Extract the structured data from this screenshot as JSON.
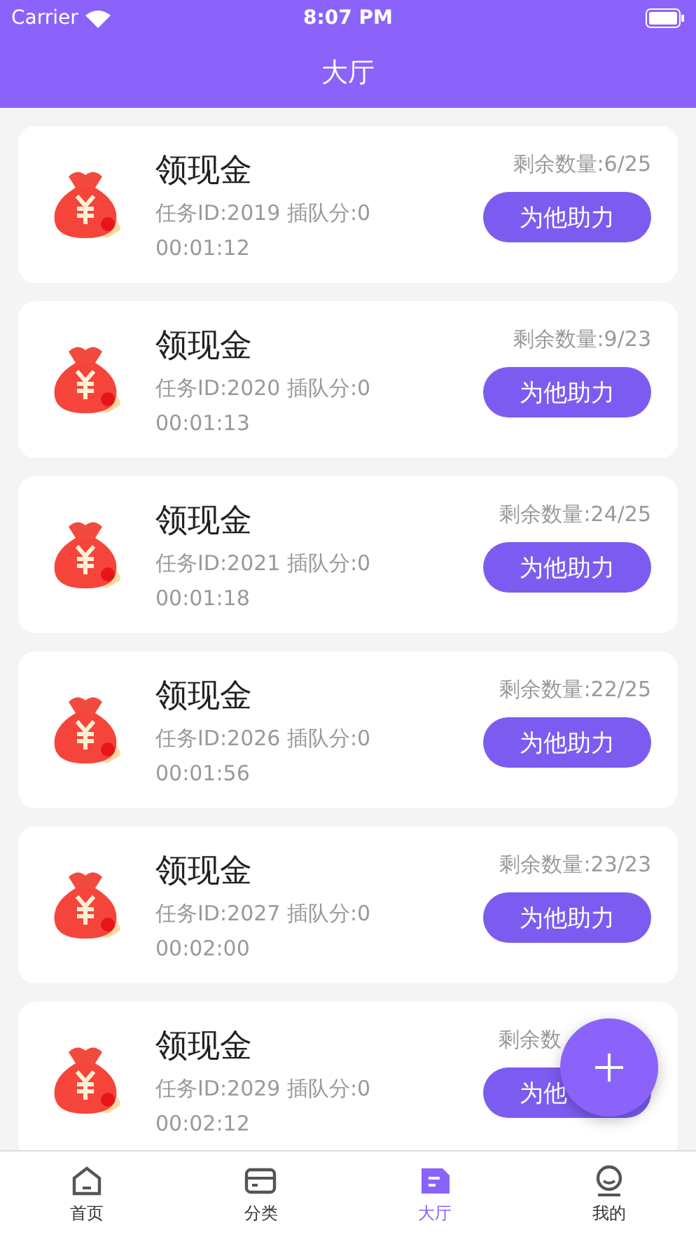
{
  "status_bar": {
    "carrier": "Carrier",
    "time": "8:07 PM"
  },
  "header": {
    "title": "大厅"
  },
  "tasks": [
    {
      "title": "领现金",
      "remaining": "剩余数量:6/25",
      "info": "任务ID:2019 插队分:0",
      "time": "00:01:12",
      "action": "为他助力",
      "cut_off": false
    },
    {
      "title": "领现金",
      "remaining": "剩余数量:9/23",
      "info": "任务ID:2020 插队分:0",
      "time": "00:01:13",
      "action": "为他助力",
      "cut_off": false
    },
    {
      "title": "领现金",
      "remaining": "剩余数量:24/25",
      "info": "任务ID:2021 插队分:0",
      "time": "00:01:18",
      "action": "为他助力",
      "cut_off": false
    },
    {
      "title": "领现金",
      "remaining": "剩余数量:22/25",
      "info": "任务ID:2026 插队分:0",
      "time": "00:01:56",
      "action": "为他助力",
      "cut_off": false
    },
    {
      "title": "领现金",
      "remaining": "剩余数量:23/23",
      "info": "任务ID:2027 插队分:0",
      "time": "00:02:00",
      "action": "为他助力",
      "cut_off": false
    },
    {
      "title": "领现金",
      "remaining": "剩余数",
      "info": "任务ID:2029 插队分:0",
      "time": "00:02:12",
      "action": "为他",
      "cut_off": true
    }
  ],
  "tabs": [
    {
      "label": "首页",
      "kind": "home",
      "selected": false
    },
    {
      "label": "分类",
      "kind": "category",
      "selected": false
    },
    {
      "label": "大厅",
      "kind": "hall",
      "selected": true
    },
    {
      "label": "我的",
      "kind": "profile",
      "selected": false
    }
  ]
}
